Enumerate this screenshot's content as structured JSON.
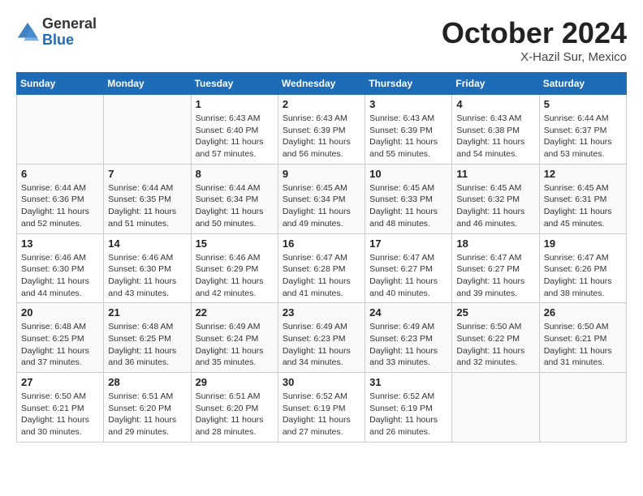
{
  "header": {
    "logo_general": "General",
    "logo_blue": "Blue",
    "month_title": "October 2024",
    "location": "X-Hazil Sur, Mexico"
  },
  "days_of_week": [
    "Sunday",
    "Monday",
    "Tuesday",
    "Wednesday",
    "Thursday",
    "Friday",
    "Saturday"
  ],
  "weeks": [
    [
      {
        "day": "",
        "empty": true
      },
      {
        "day": "",
        "empty": true
      },
      {
        "day": "1",
        "sunrise": "6:43 AM",
        "sunset": "6:40 PM",
        "daylight": "11 hours and 57 minutes."
      },
      {
        "day": "2",
        "sunrise": "6:43 AM",
        "sunset": "6:39 PM",
        "daylight": "11 hours and 56 minutes."
      },
      {
        "day": "3",
        "sunrise": "6:43 AM",
        "sunset": "6:39 PM",
        "daylight": "11 hours and 55 minutes."
      },
      {
        "day": "4",
        "sunrise": "6:43 AM",
        "sunset": "6:38 PM",
        "daylight": "11 hours and 54 minutes."
      },
      {
        "day": "5",
        "sunrise": "6:44 AM",
        "sunset": "6:37 PM",
        "daylight": "11 hours and 53 minutes."
      }
    ],
    [
      {
        "day": "6",
        "sunrise": "6:44 AM",
        "sunset": "6:36 PM",
        "daylight": "11 hours and 52 minutes."
      },
      {
        "day": "7",
        "sunrise": "6:44 AM",
        "sunset": "6:35 PM",
        "daylight": "11 hours and 51 minutes."
      },
      {
        "day": "8",
        "sunrise": "6:44 AM",
        "sunset": "6:34 PM",
        "daylight": "11 hours and 50 minutes."
      },
      {
        "day": "9",
        "sunrise": "6:45 AM",
        "sunset": "6:34 PM",
        "daylight": "11 hours and 49 minutes."
      },
      {
        "day": "10",
        "sunrise": "6:45 AM",
        "sunset": "6:33 PM",
        "daylight": "11 hours and 48 minutes."
      },
      {
        "day": "11",
        "sunrise": "6:45 AM",
        "sunset": "6:32 PM",
        "daylight": "11 hours and 46 minutes."
      },
      {
        "day": "12",
        "sunrise": "6:45 AM",
        "sunset": "6:31 PM",
        "daylight": "11 hours and 45 minutes."
      }
    ],
    [
      {
        "day": "13",
        "sunrise": "6:46 AM",
        "sunset": "6:30 PM",
        "daylight": "11 hours and 44 minutes."
      },
      {
        "day": "14",
        "sunrise": "6:46 AM",
        "sunset": "6:30 PM",
        "daylight": "11 hours and 43 minutes."
      },
      {
        "day": "15",
        "sunrise": "6:46 AM",
        "sunset": "6:29 PM",
        "daylight": "11 hours and 42 minutes."
      },
      {
        "day": "16",
        "sunrise": "6:47 AM",
        "sunset": "6:28 PM",
        "daylight": "11 hours and 41 minutes."
      },
      {
        "day": "17",
        "sunrise": "6:47 AM",
        "sunset": "6:27 PM",
        "daylight": "11 hours and 40 minutes."
      },
      {
        "day": "18",
        "sunrise": "6:47 AM",
        "sunset": "6:27 PM",
        "daylight": "11 hours and 39 minutes."
      },
      {
        "day": "19",
        "sunrise": "6:47 AM",
        "sunset": "6:26 PM",
        "daylight": "11 hours and 38 minutes."
      }
    ],
    [
      {
        "day": "20",
        "sunrise": "6:48 AM",
        "sunset": "6:25 PM",
        "daylight": "11 hours and 37 minutes."
      },
      {
        "day": "21",
        "sunrise": "6:48 AM",
        "sunset": "6:25 PM",
        "daylight": "11 hours and 36 minutes."
      },
      {
        "day": "22",
        "sunrise": "6:49 AM",
        "sunset": "6:24 PM",
        "daylight": "11 hours and 35 minutes."
      },
      {
        "day": "23",
        "sunrise": "6:49 AM",
        "sunset": "6:23 PM",
        "daylight": "11 hours and 34 minutes."
      },
      {
        "day": "24",
        "sunrise": "6:49 AM",
        "sunset": "6:23 PM",
        "daylight": "11 hours and 33 minutes."
      },
      {
        "day": "25",
        "sunrise": "6:50 AM",
        "sunset": "6:22 PM",
        "daylight": "11 hours and 32 minutes."
      },
      {
        "day": "26",
        "sunrise": "6:50 AM",
        "sunset": "6:21 PM",
        "daylight": "11 hours and 31 minutes."
      }
    ],
    [
      {
        "day": "27",
        "sunrise": "6:50 AM",
        "sunset": "6:21 PM",
        "daylight": "11 hours and 30 minutes."
      },
      {
        "day": "28",
        "sunrise": "6:51 AM",
        "sunset": "6:20 PM",
        "daylight": "11 hours and 29 minutes."
      },
      {
        "day": "29",
        "sunrise": "6:51 AM",
        "sunset": "6:20 PM",
        "daylight": "11 hours and 28 minutes."
      },
      {
        "day": "30",
        "sunrise": "6:52 AM",
        "sunset": "6:19 PM",
        "daylight": "11 hours and 27 minutes."
      },
      {
        "day": "31",
        "sunrise": "6:52 AM",
        "sunset": "6:19 PM",
        "daylight": "11 hours and 26 minutes."
      },
      {
        "day": "",
        "empty": true
      },
      {
        "day": "",
        "empty": true
      }
    ]
  ]
}
